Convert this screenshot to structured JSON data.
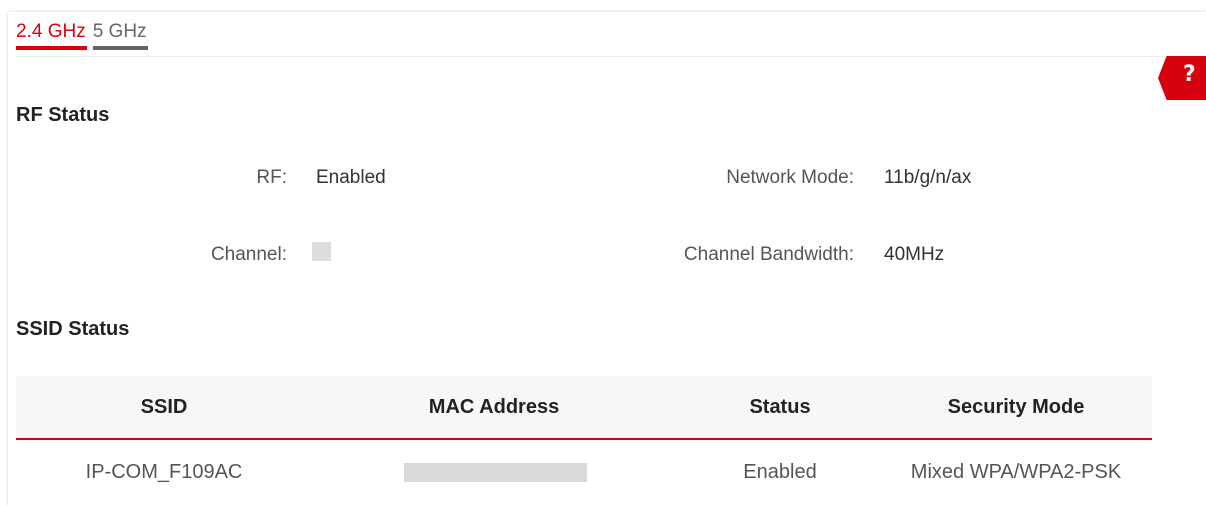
{
  "tabs": [
    {
      "label": "2.4 GHz",
      "active": true
    },
    {
      "label": "5 GHz",
      "active": false
    }
  ],
  "help": {
    "label": "?"
  },
  "rf_status": {
    "title": "RF Status",
    "rf_label": "RF:",
    "rf_value": "Enabled",
    "network_mode_label": "Network Mode:",
    "network_mode_value": "11b/g/n/ax",
    "channel_label": "Channel:",
    "channel_value": "",
    "bandwidth_label": "Channel Bandwidth:",
    "bandwidth_value": "40MHz"
  },
  "ssid_status": {
    "title": "SSID Status",
    "columns": [
      "SSID",
      "MAC Address",
      "Status",
      "Security Mode"
    ],
    "rows": [
      {
        "ssid": "IP-COM_F109AC",
        "mac": "",
        "status": "Enabled",
        "security": "Mixed WPA/WPA2-PSK"
      }
    ]
  },
  "colors": {
    "accent": "#d7000f",
    "inactive_tab": "#666666",
    "header_bg": "#f7f7f7"
  }
}
